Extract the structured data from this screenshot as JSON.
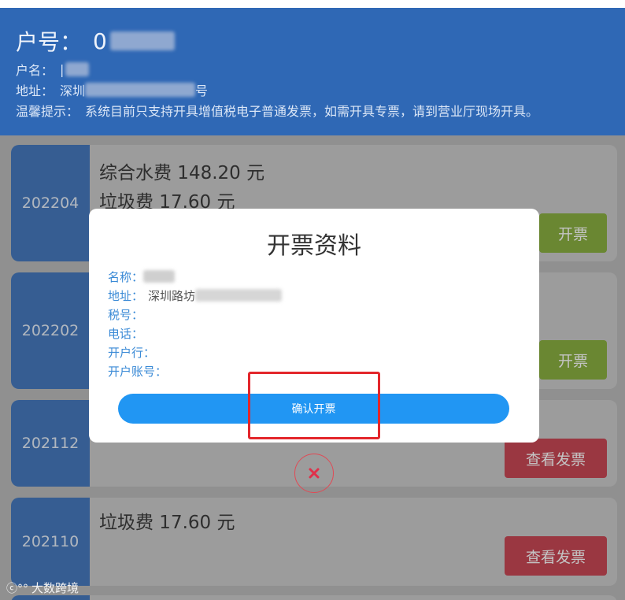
{
  "header": {
    "account_label": "户号：",
    "account_value": "0",
    "name_label": "户名：",
    "name_value": "|",
    "address_label": "地址：",
    "address_value": "深圳",
    "address_suffix": "号",
    "notice_label": "温馨提示：",
    "notice_text": "系统目前只支持开具增值税电子普通发票，如需开具专票，请到营业厅现场开具。"
  },
  "cards": [
    {
      "period": "202204",
      "fees": [
        "综合水费 148.20 元",
        "垃圾费 17.60 元"
      ],
      "button": "开票"
    },
    {
      "period": "202202",
      "fees": [],
      "button": "开票"
    },
    {
      "period": "202112",
      "fees": [],
      "button": "查看发票"
    },
    {
      "period": "202110",
      "fees": [
        "垃圾费 17.60 元"
      ],
      "button": "查看发票"
    }
  ],
  "modal": {
    "title": "开票资料",
    "fields": [
      {
        "label": "名称：",
        "value": ""
      },
      {
        "label": "地址：",
        "value": "深圳路坊"
      },
      {
        "label": "税号：",
        "value": ""
      },
      {
        "label": "电话：",
        "value": ""
      },
      {
        "label": "开户行：",
        "value": ""
      },
      {
        "label": "开户账号：",
        "value": ""
      }
    ],
    "confirm_label": "确认开票"
  },
  "watermark": "大数跨境",
  "icons": {
    "close": "close-icon"
  },
  "colors": {
    "header": "#2f68b5",
    "green_button": "#7ba529",
    "red_button": "#c2303f",
    "confirm": "#2196f3",
    "highlight": "#e3262b"
  }
}
